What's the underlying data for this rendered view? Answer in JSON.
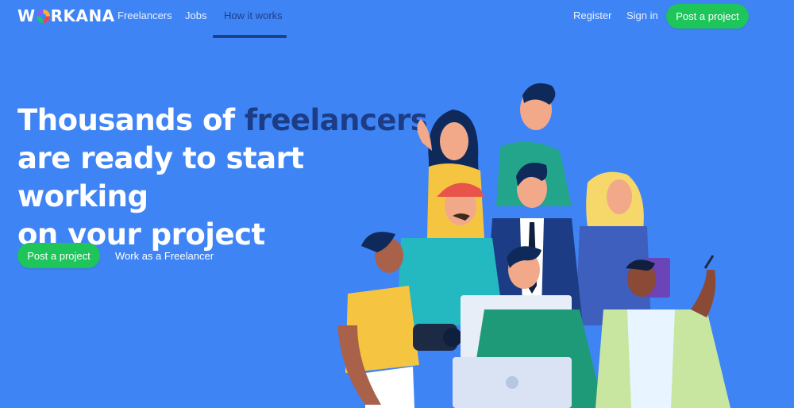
{
  "header": {
    "logo_text_left": "W",
    "logo_text_right": "RKANA",
    "nav": [
      {
        "label": "Freelancers"
      },
      {
        "label": "Jobs"
      },
      {
        "label": "How it works"
      }
    ],
    "register_label": "Register",
    "signin_label": "Sign in",
    "post_project_label": "Post a project"
  },
  "hero": {
    "title_part1": "Thousands of ",
    "title_accent": "freelancers",
    "title_part2": "are ready to start working",
    "title_part3": "on your project",
    "primary_button": "Post a project",
    "secondary_link": "Work as a Freelancer"
  },
  "colors": {
    "background": "#3f84f5",
    "accent_dark": "#1c3d86",
    "button_green": "#1ec55b"
  }
}
